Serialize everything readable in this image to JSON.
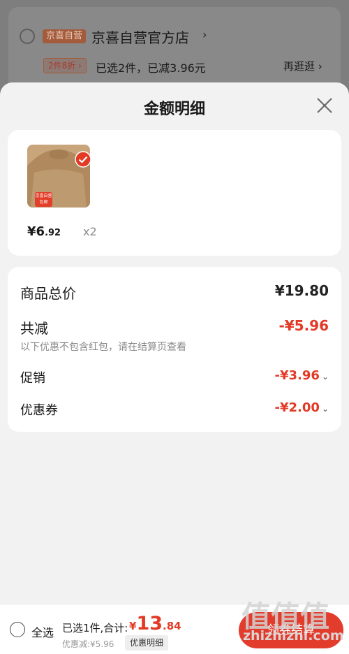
{
  "store": {
    "tag": "京喜自营",
    "name": "京喜自营官方店",
    "chevron": "›",
    "promo_tag": "2件8折 ›",
    "promo_text": "已选2件，已减3.96元",
    "promo_more": "再逛逛 ›"
  },
  "sheet": {
    "title": "金额明细"
  },
  "product": {
    "badge": "京喜自营\n包邮",
    "price_currency": "¥",
    "price_int": "6",
    "price_dec": ".92",
    "qty": "x2"
  },
  "detail": {
    "total_label": "商品总价",
    "total_value": "¥19.80",
    "discount_label": "共减",
    "discount_value": "-¥5.96",
    "note": "以下优惠不包含红包，请在结算页查看",
    "promo_label": "促销",
    "promo_value": "-¥3.96",
    "coupon_label": "优惠券",
    "coupon_value": "-¥2.00",
    "chevron": "⌄"
  },
  "bottom": {
    "select_all": "全选",
    "selected": "已选1件,合计:",
    "total_currency": "¥",
    "total_int": "13",
    "total_dec": ".84",
    "discount": "优惠减:¥5.96",
    "detail_button": "优惠明细",
    "checkout": "领券结算"
  },
  "watermark": {
    "chars": "值值值",
    "url": "zhizhizhi.com"
  },
  "colors": {
    "accent_red": "#e33a26",
    "sheet_bg": "#f2f2f2",
    "overlay": "#7d7d7d"
  }
}
